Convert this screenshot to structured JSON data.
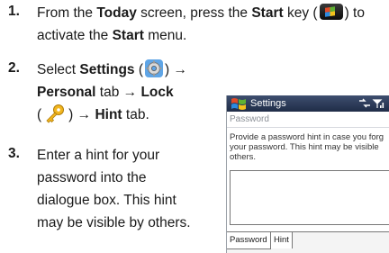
{
  "steps": [
    {
      "number": "1.",
      "line1": {
        "pre": "From the ",
        "b1": "Today",
        "mid": " screen, press the ",
        "b2": "Start",
        "post1": " key (",
        "post2": ") to"
      },
      "line2": {
        "pre": "activate the ",
        "b1": "Start",
        "post": " menu."
      }
    },
    {
      "number": "2.",
      "line1": {
        "pre": "Select ",
        "b1": "Settings",
        "pre2": " (",
        "post": ") →"
      },
      "line2": {
        "b1": "Personal",
        "mid": " tab → ",
        "b2": "Lock"
      },
      "line3": {
        "pre": "(",
        "post": ") → ",
        "b1": "Hint",
        "post2": " tab."
      }
    },
    {
      "number": "3.",
      "lines": [
        "Enter a hint for your",
        "password into the",
        "dialogue box. This hint",
        "may be visible by others."
      ]
    }
  ],
  "screen": {
    "title": "Settings",
    "subtitle": "Password",
    "description": [
      "Provide a password hint in case you forg",
      "your password.  This hint may be visible",
      "others."
    ],
    "tabs": [
      "Password",
      "Hint"
    ],
    "active_tab": "Hint"
  },
  "colors": {
    "titlebar": "#2b3a5a",
    "start_key": "#111111"
  },
  "icons": [
    "start-key-icon",
    "settings-icon",
    "lock-key-icon",
    "windows-flag-icon",
    "signal-icon"
  ]
}
